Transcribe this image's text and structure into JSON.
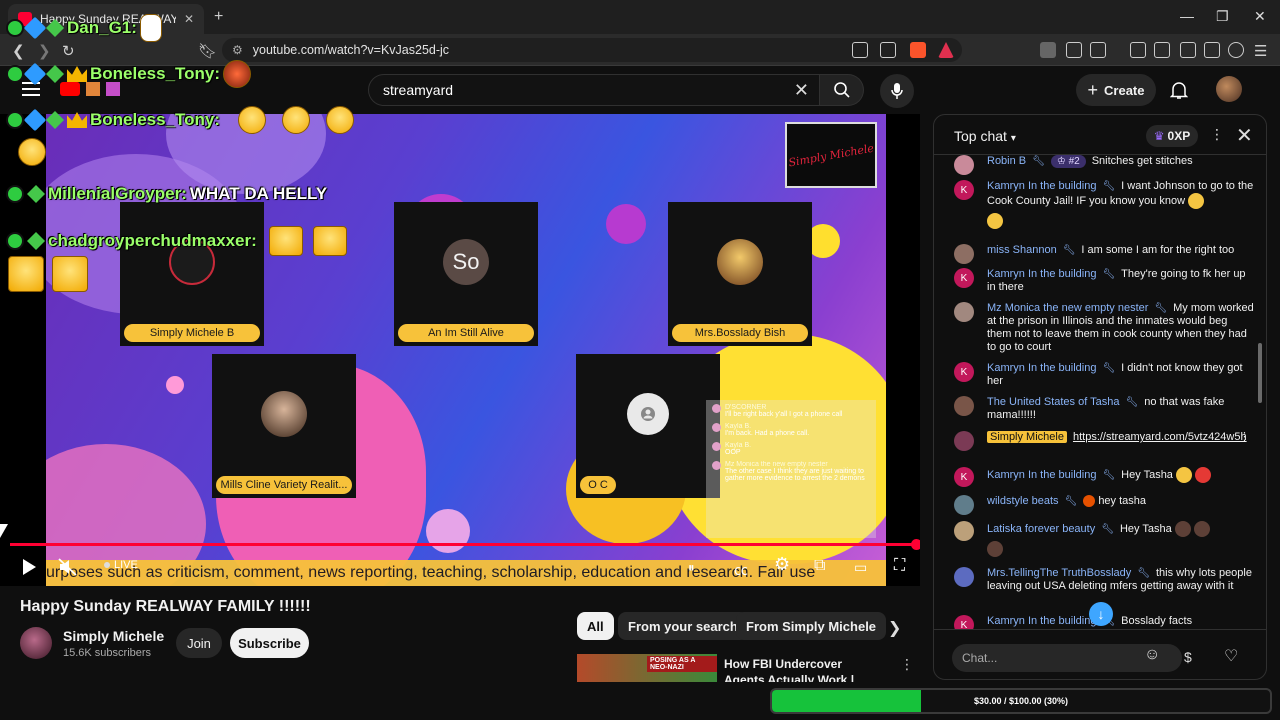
{
  "browser": {
    "tab_title": "Happy Sunday REALWAY FAMI",
    "url": "youtube.com/watch?v=KvJas25d-jc"
  },
  "masthead": {
    "search_query": "streamyard",
    "create_label": "Create"
  },
  "video": {
    "participants": [
      {
        "name": "Simply Michele B"
      },
      {
        "name": "An Im Still Alive",
        "initials": "So"
      },
      {
        "name": "Mrs.Bosslady Bish"
      },
      {
        "name": "Mills Cline Variety Realit..."
      },
      {
        "name": "O C"
      }
    ],
    "logo_text": "Simply Michele",
    "ticker_text": "urposes such as criticism, comment, news reporting, teaching, scholarship, education and research. Fair use",
    "live_label": "LIVE",
    "mini_chat": [
      {
        "name": "D'SCORNER",
        "text": "I'll be right back y'all I got a phone call"
      },
      {
        "name": "Kayla B.",
        "text": "I'm back. Had a phone call."
      },
      {
        "name": "Kayla B.",
        "text": "OOP"
      },
      {
        "name": "Mz Monica the new empty nester",
        "text": "The other case I think they are just waiting to gather more evidence to arrest the 2 demons"
      }
    ],
    "watch_progress": 1.0
  },
  "overlay_chat": [
    {
      "user": "Dan_G1:",
      "message": ""
    },
    {
      "user": "Boneless_Tony:",
      "message": ""
    },
    {
      "user": "Boneless_Tony:",
      "message": ""
    },
    {
      "user": "MillenialGroyper:",
      "message": "WHAT DA HELLY"
    },
    {
      "user": "chadgroyperchudmaxxer:",
      "message": ""
    }
  ],
  "below": {
    "title": "Happy Sunday REALWAY FAMILY !!!!!!",
    "channel": "Simply Michele",
    "subscribers": "15.6K subscribers",
    "join_label": "Join",
    "subscribe_label": "Subscribe",
    "chips": [
      "All",
      "From your search",
      "From Simply Michele"
    ],
    "reco_title": "How FBI Undercover Agents Actually Work | Authorized",
    "reco_thumb_text": "POSING AS A NEO-NAZI"
  },
  "chat": {
    "header": "Top chat",
    "xp": "0XP",
    "input_placeholder": "Chat...",
    "messages": [
      {
        "author": "Robin B",
        "rank": "#2",
        "text": "Snitches get stitches",
        "avatar_letter": "",
        "avatar_color": "#c98a9a"
      },
      {
        "author": "Kamryn In the building",
        "text": "I want Johnson to go to the Cook County Jail! IF you know you know",
        "avatar_letter": "K",
        "avatar_color": "#c2185b"
      },
      {
        "author": "miss Shannon",
        "text": "I am some I am for the right too",
        "avatar_letter": "",
        "avatar_color": "#8d6e63"
      },
      {
        "author": "Kamryn In the building",
        "text": "They're going to fk her up in there",
        "avatar_letter": "K",
        "avatar_color": "#c2185b"
      },
      {
        "author": "Mz Monica the new empty nester",
        "text": "My mom worked at the prison in Illinois and the inmates would beg them not to leave them in cook county when they had to go to court",
        "avatar_letter": "",
        "avatar_color": "#a1887f"
      },
      {
        "author": "Kamryn In the building",
        "text": "I didn't not know they got her",
        "avatar_letter": "K",
        "avatar_color": "#c2185b"
      },
      {
        "author": "The United States of Tasha",
        "text": "no that was fake mama!!!!!!",
        "avatar_letter": "",
        "avatar_color": "#795548"
      },
      {
        "author": "Simply Michele",
        "link": "https://streamyard.com/5vtz424w5h",
        "avatar_letter": "",
        "avatar_color": "#7b3a55"
      },
      {
        "author": "Kamryn In the building",
        "text": "Hey Tasha",
        "avatar_letter": "K",
        "avatar_color": "#c2185b"
      },
      {
        "author": "wildstyle beats",
        "text": "hey tasha",
        "avatar_letter": "",
        "avatar_color": "#607d8b"
      },
      {
        "author": "Latiska forever beauty",
        "text": "Hey Tasha",
        "avatar_letter": "",
        "avatar_color": "#bca07a"
      },
      {
        "author": "Mrs.TellingThe TruthBosslady",
        "text": "this why lots people leaving out USA deleting mfers getting away with it",
        "avatar_letter": "",
        "avatar_color": "#5c6bc0"
      },
      {
        "author": "Kamryn In the building",
        "text": "Bosslady facts",
        "avatar_letter": "K",
        "avatar_color": "#c2185b"
      }
    ]
  },
  "goal": {
    "text": "$30.00 / $100.00 (30%)",
    "progress": 0.3
  }
}
